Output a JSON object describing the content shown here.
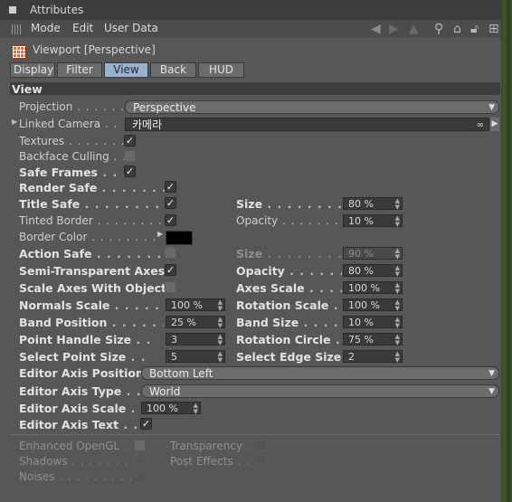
{
  "window": {
    "title": "Attributes"
  },
  "menu": {
    "mode": "Mode",
    "edit": "Edit",
    "user_data": "User Data"
  },
  "header": {
    "title": "Viewport [Perspective]"
  },
  "tabs": [
    "Display",
    "Filter",
    "View",
    "Back",
    "HUD"
  ],
  "active_tab": "View",
  "section": {
    "title": "View"
  },
  "fields": {
    "projection": {
      "label": "Projection",
      "value": "Perspective"
    },
    "linked_camera": {
      "label": "Linked Camera",
      "value": "카메라"
    },
    "textures": {
      "label": "Textures",
      "checked": true
    },
    "backface_culling": {
      "label": "Backface Culling",
      "checked": false
    },
    "safe_frames": {
      "label": "Safe Frames",
      "checked": true
    },
    "render_safe": {
      "label": "Render Safe",
      "checked": true
    },
    "title_safe": {
      "label": "Title Safe",
      "checked": true
    },
    "title_size": {
      "label": "Size",
      "value": "80 %"
    },
    "tinted_border": {
      "label": "Tinted Border",
      "checked": true
    },
    "tinted_opacity": {
      "label": "Opacity",
      "value": "10 %"
    },
    "border_color": {
      "label": "Border Color",
      "color": "#000000"
    },
    "action_safe": {
      "label": "Action Safe",
      "checked": false
    },
    "action_size": {
      "label": "Size",
      "value": "90 %"
    },
    "semi_transparent_axes": {
      "label": "Semi-Transparent Axes",
      "checked": true
    },
    "axes_opacity": {
      "label": "Opacity",
      "value": "80 %"
    },
    "scale_axes_with_object": {
      "label": "Scale Axes With Object",
      "checked": false
    },
    "axes_scale": {
      "label": "Axes Scale",
      "value": "100 %"
    },
    "normals_scale": {
      "label": "Normals Scale",
      "value": "100 %"
    },
    "rotation_scale": {
      "label": "Rotation Scale",
      "value": "100 %"
    },
    "band_position": {
      "label": "Band Position",
      "value": "25 %"
    },
    "band_size": {
      "label": "Band Size",
      "value": "10 %"
    },
    "point_handle_size": {
      "label": "Point Handle Size",
      "value": "3"
    },
    "rotation_circle": {
      "label": "Rotation Circle",
      "value": "75 %"
    },
    "select_point_size": {
      "label": "Select Point Size",
      "value": "5"
    },
    "select_edge_size": {
      "label": "Select Edge Size",
      "value": "2"
    },
    "editor_axis_position": {
      "label": "Editor Axis Position",
      "value": "Bottom Left"
    },
    "editor_axis_type": {
      "label": "Editor Axis Type",
      "value": "World"
    },
    "editor_axis_scale": {
      "label": "Editor Axis Scale",
      "value": "100 %"
    },
    "editor_axis_text": {
      "label": "Editor Axis Text",
      "checked": true
    },
    "enhanced_opengl": {
      "label": "Enhanced OpenGL",
      "checked": false
    },
    "transparency": {
      "label": "Transparency",
      "checked": false
    },
    "shadows": {
      "label": "Shadows",
      "checked": false
    },
    "post_effects": {
      "label": "Post Effects",
      "checked": false
    },
    "noises": {
      "label": "Noises",
      "checked": false
    }
  },
  "colors": {
    "panel": "#575757",
    "active_tab": "#9cb1cc",
    "titlebar": "#3d3d3d"
  }
}
